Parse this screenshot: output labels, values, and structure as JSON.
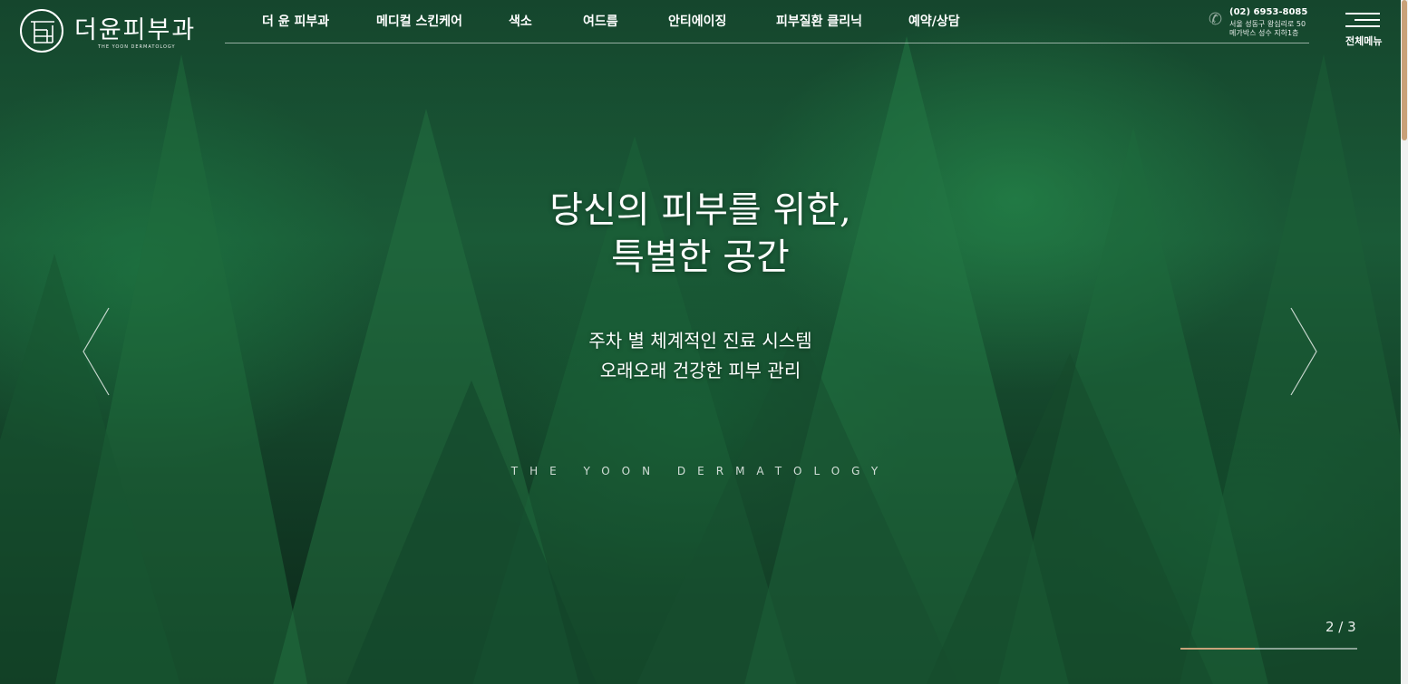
{
  "brand": {
    "name": "더윤피부과",
    "subtitle": "THE YOON DERMATOLOGY"
  },
  "nav": {
    "items": [
      {
        "label": "더 윤 피부과"
      },
      {
        "label": "메디컬 스킨케어"
      },
      {
        "label": "색소"
      },
      {
        "label": "여드름"
      },
      {
        "label": "안티에이징"
      },
      {
        "label": "피부질환 클리닉"
      },
      {
        "label": "예약/상담"
      }
    ]
  },
  "contact": {
    "phone": "(02) 6953-8085",
    "address_line1": "서울 성동구 왕십리로 50",
    "address_line2": "메가박스 성수 지하1층",
    "icon": "phone-icon"
  },
  "menu": {
    "label": "전체메뉴",
    "icon": "hamburger-icon"
  },
  "hero": {
    "headline_line1": "당신의 피부를 위한,",
    "headline_line2": "특별한 공간",
    "sub_line1": "주차 별 체계적인 진료 시스템",
    "sub_line2": "오래오래 건강한 피부 관리",
    "brand_line": "THE YOON DERMATOLOGY"
  },
  "slider": {
    "counter": "2 / 3",
    "current": 2,
    "total": 3,
    "progress_fraction": 0.42,
    "prev_icon": "chevron-left-icon",
    "next_icon": "chevron-right-icon"
  },
  "colors": {
    "accent": "#c7a37a",
    "forest": "#1a5a37"
  }
}
